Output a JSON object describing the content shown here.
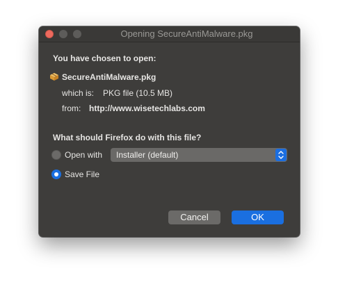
{
  "window": {
    "title": "Opening SecureAntiMalware.pkg"
  },
  "dialog": {
    "intro": "You have chosen to open:",
    "file_name": "SecureAntiMalware.pkg",
    "which_is_label": "which is:",
    "which_is_value": "PKG file (10.5 MB)",
    "from_label": "from:",
    "from_value": "http://www.wisetechlabs.com",
    "question": "What should Firefox do with this file?",
    "open_with_label": "Open with",
    "open_with_selected": "Installer (default)",
    "save_file_label": "Save File",
    "selected_option": "Save File"
  },
  "buttons": {
    "cancel": "Cancel",
    "ok": "OK"
  },
  "colors": {
    "accent": "#1a6fe0",
    "dialog_background": "#3e3d3b",
    "close_button": "#ed6a5e"
  },
  "icons": {
    "file": "package-icon",
    "select": "chevron-up-down-icon"
  }
}
